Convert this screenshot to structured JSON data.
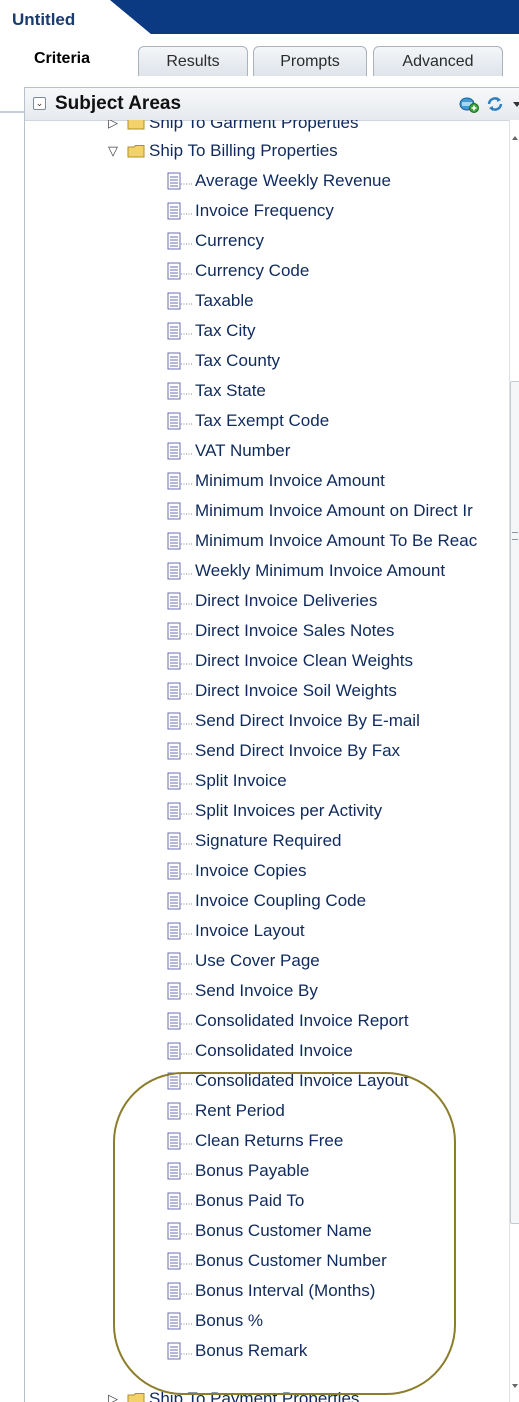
{
  "document": {
    "title": "Untitled"
  },
  "tabs": [
    {
      "label": "Criteria",
      "active": true
    },
    {
      "label": "Results",
      "active": false
    },
    {
      "label": "Prompts",
      "active": false
    },
    {
      "label": "Advanced",
      "active": false
    }
  ],
  "panel": {
    "title": "Subject Areas",
    "collapse_icon": "chevron-down-icon",
    "actions": [
      "add-subject-area-icon",
      "refresh-icon",
      "dropdown-caret-icon"
    ]
  },
  "tree": {
    "folders": {
      "garment": "Ship To Garment Properties",
      "billing": "Ship To Billing Properties",
      "payment": "Ship To Payment Properties"
    },
    "columns": [
      "Average Weekly Revenue",
      "Invoice Frequency",
      "Currency",
      "Currency Code",
      "Taxable",
      "Tax City",
      "Tax County",
      "Tax State",
      "Tax Exempt Code",
      "VAT Number",
      "Minimum Invoice Amount",
      "Minimum Invoice Amount on Direct Ir",
      "Minimum Invoice Amount To Be Reac",
      "Weekly Minimum Invoice Amount",
      "Direct Invoice Deliveries",
      "Direct Invoice Sales Notes",
      "Direct Invoice Clean Weights",
      "Direct Invoice Soil Weights",
      "Send Direct Invoice By E-mail",
      "Send Direct Invoice By Fax",
      "Split Invoice",
      "Split Invoices per Activity",
      "Signature Required",
      "Invoice Copies",
      "Invoice Coupling Code",
      "Invoice Layout",
      "Use Cover Page",
      "Send Invoice By",
      "Consolidated Invoice Report",
      "Consolidated Invoice",
      "Consolidated Invoice Layout",
      "Rent Period",
      "Clean Returns Free",
      "Bonus Payable",
      "Bonus Paid To",
      "Bonus Customer Name",
      "Bonus Customer Number",
      "Bonus Interval (Months)",
      "Bonus %",
      "Bonus Remark"
    ]
  },
  "colors": {
    "title_stripe": "#0b3a82",
    "label_text": "#0f2a5c",
    "folder": "#f2d36b",
    "highlight": "#8b7d2a"
  }
}
